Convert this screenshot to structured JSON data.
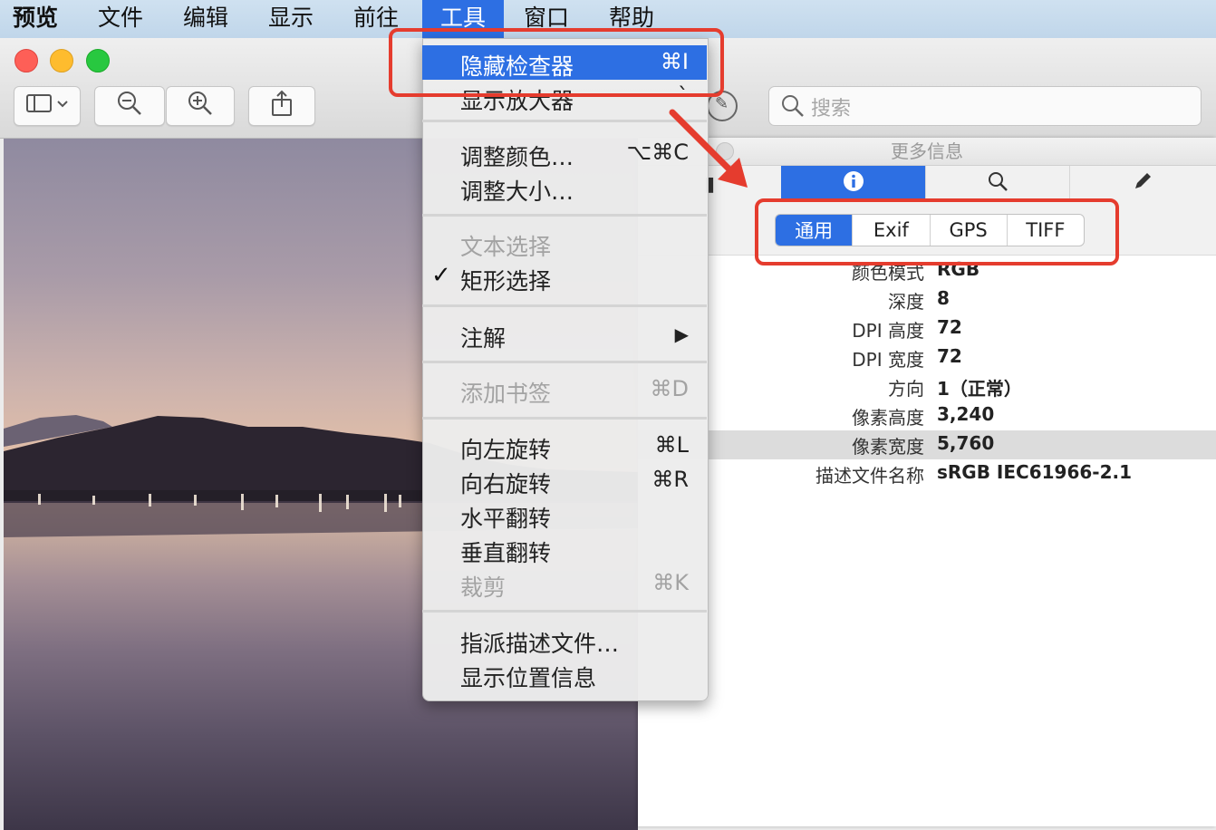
{
  "menubar": {
    "app": "预览",
    "items": [
      "文件",
      "编辑",
      "显示",
      "前往",
      "工具",
      "窗口",
      "帮助"
    ]
  },
  "toolbar": {
    "search_placeholder": "搜索"
  },
  "tools_menu": {
    "items": [
      {
        "label": "隐藏检查器",
        "shortcut": "⌘I",
        "highlighted": true
      },
      {
        "label": "显示放大器",
        "shortcut": "`"
      },
      {
        "label": "调整颜色…",
        "shortcut": "⌥⌘C"
      },
      {
        "label": "调整大小…",
        "shortcut": ""
      },
      {
        "label": "文本选择",
        "shortcut": "",
        "disabled": true
      },
      {
        "label": "矩形选择",
        "shortcut": "",
        "checked": true
      },
      {
        "label": "注解",
        "shortcut": "▶"
      },
      {
        "label": "添加书签",
        "shortcut": "⌘D",
        "disabled": true
      },
      {
        "label": "向左旋转",
        "shortcut": "⌘L"
      },
      {
        "label": "向右旋转",
        "shortcut": "⌘R"
      },
      {
        "label": "水平翻转",
        "shortcut": ""
      },
      {
        "label": "垂直翻转",
        "shortcut": ""
      },
      {
        "label": "裁剪",
        "shortcut": "⌘K",
        "disabled": true
      },
      {
        "label": "指派描述文件…",
        "shortcut": ""
      },
      {
        "label": "显示位置信息",
        "shortcut": ""
      }
    ],
    "checkmark": "✓"
  },
  "inspector": {
    "title": "更多信息",
    "segments": [
      "通用",
      "Exif",
      "GPS",
      "TIFF"
    ],
    "selected_segment": "通用",
    "properties": [
      {
        "key": "颜色模式",
        "value": "RGB"
      },
      {
        "key": "深度",
        "value": "8"
      },
      {
        "key": "DPI 高度",
        "value": "72"
      },
      {
        "key": "DPI 宽度",
        "value": "72"
      },
      {
        "key": "方向",
        "value": "1（正常）"
      },
      {
        "key": "像素高度",
        "value": "3,240"
      },
      {
        "key": "像素宽度",
        "value": "5,760",
        "highlighted": true
      },
      {
        "key": "描述文件名称",
        "value": "sRGB IEC61966-2.1"
      }
    ]
  },
  "colors": {
    "accent": "#2d6fe3",
    "annotation": "#e53c2e"
  }
}
